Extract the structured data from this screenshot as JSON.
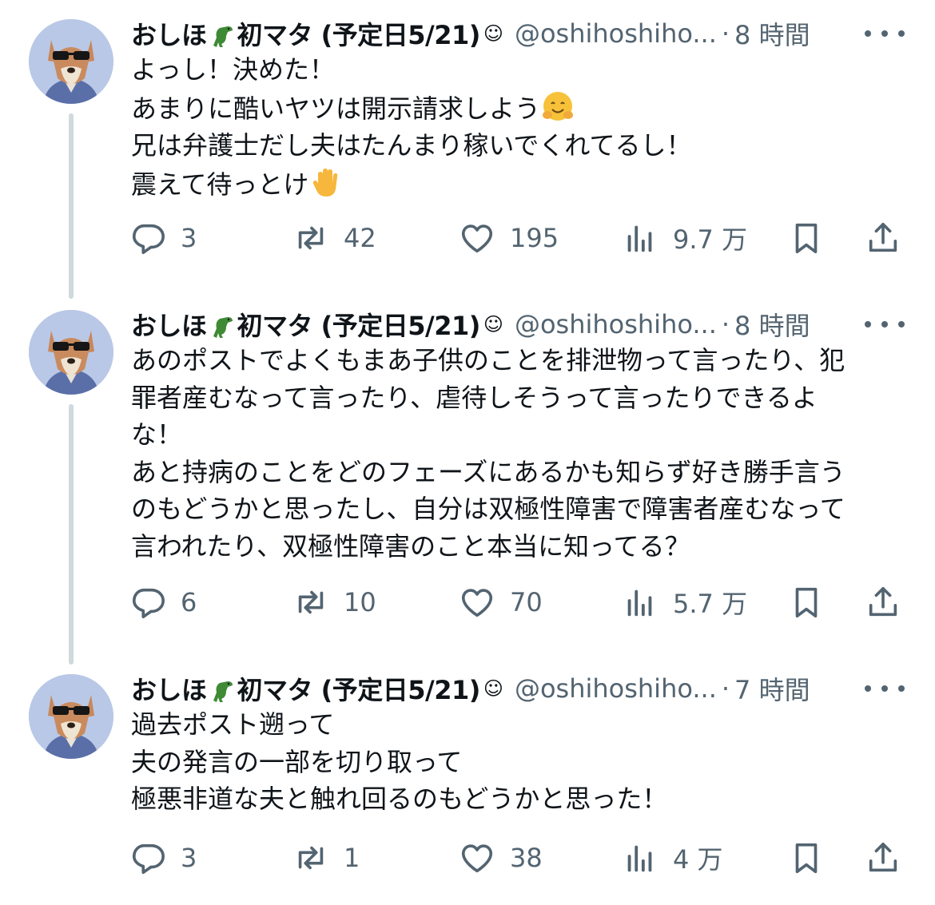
{
  "author": {
    "name_a": "おしほ",
    "name_b": "初マタ (予定日5/21)",
    "name_emoji": "t-rex",
    "verified_glyph": "☺",
    "handle": "@oshihoshiho...",
    "separator": "·",
    "avatar_icon": "fox-with-sunglasses-avatar"
  },
  "tweets": [
    {
      "time": "8 時間",
      "lines": [
        "よっし！決めた！",
        "あまりに酷いヤツは開示請求しよう",
        "兄は弁護士だし夫はたんまり稼いでくれてるし！",
        "震えて待っとけ"
      ],
      "line_emojis": {
        "1": "hugging-face",
        "3": "raised-hand"
      },
      "stats": {
        "replies": "3",
        "reposts": "42",
        "likes": "195",
        "views": "9.7 万"
      }
    },
    {
      "time": "8 時間",
      "lines": [
        "あのポストでよくもまあ子供のことを排泄物って言ったり、犯",
        "罪者産むなって言ったり、虐待しそうって言ったりできるよ",
        "な！",
        "あと持病のことをどのフェーズにあるかも知らず好き勝手言う",
        "のもどうかと思ったし、自分は双極性障害で障害者産むなって",
        "言われたり、双極性障害のこと本当に知ってる？"
      ],
      "stats": {
        "replies": "6",
        "reposts": "10",
        "likes": "70",
        "views": "5.7 万"
      }
    },
    {
      "time": "7 時間",
      "lines": [
        "過去ポスト遡って",
        "夫の発言の一部を切り取って",
        "極悪非道な夫と触れ回るのもどうかと思った！"
      ],
      "stats": {
        "replies": "3",
        "reposts": "1",
        "likes": "38",
        "views": "4 万"
      }
    }
  ],
  "colors": {
    "text": "#0f1419",
    "muted": "#536471",
    "thread_line": "#cfd9de",
    "avatar_bg": "#b9c8e6"
  },
  "icons": [
    "reply-icon",
    "repost-icon",
    "like-icon",
    "views-icon",
    "bookmark-icon",
    "share-icon",
    "more-icon"
  ]
}
